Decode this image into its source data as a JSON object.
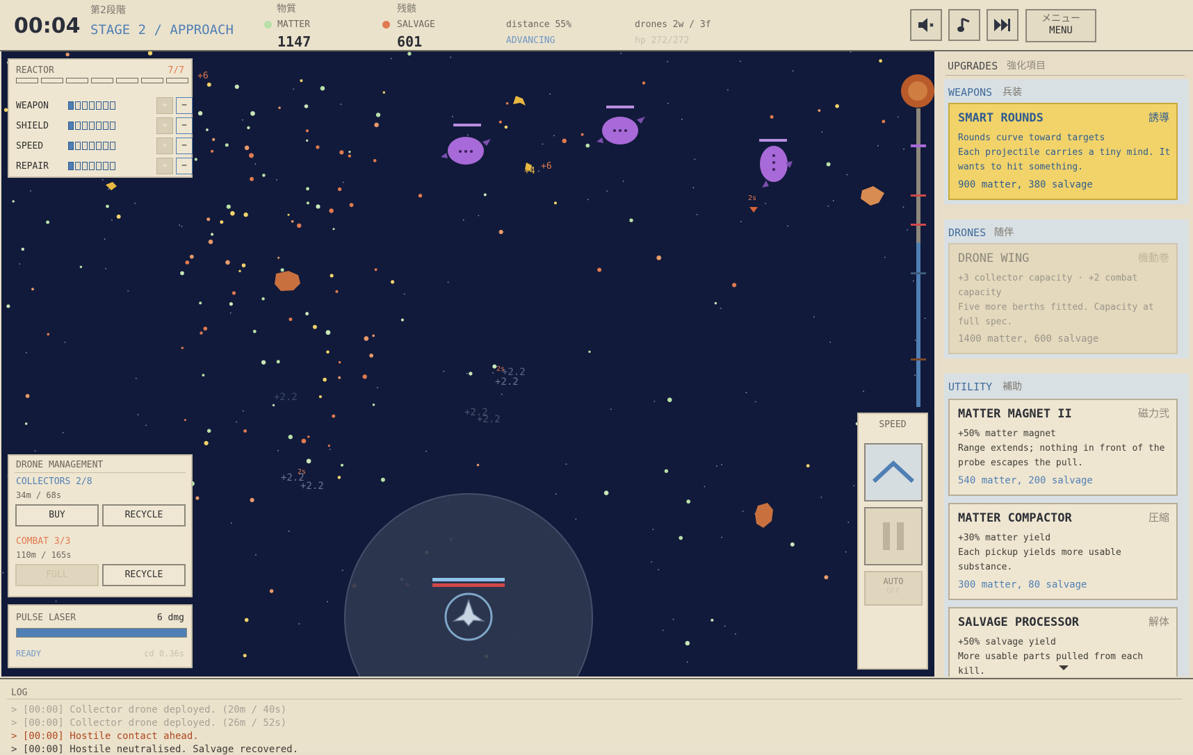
{
  "header": {
    "timer": "00:04",
    "stage_jp": "第2段階",
    "stage": "STAGE 2 / APPROACH",
    "matter_jp": "物質",
    "matter_label": "MATTER",
    "matter_value": "1147",
    "salvage_jp": "残骸",
    "salvage_label": "SALVAGE",
    "salvage_value": "601",
    "distance": "distance 55%",
    "status": "ADVANCING",
    "drones": "drones 2w / 3f",
    "hp": "hp 272/272",
    "menu_jp": "メニュー",
    "menu_label": "MENU"
  },
  "reactor": {
    "title": "REACTOR",
    "count": "7/7",
    "rows": [
      {
        "label": "WEAPON"
      },
      {
        "label": "SHIELD"
      },
      {
        "label": "SPEED"
      },
      {
        "label": "REPAIR"
      }
    ],
    "plus": "+",
    "minus": "−"
  },
  "drone_mgmt": {
    "title": "DRONE MANAGEMENT",
    "collectors": "COLLECTORS  2/8",
    "collectors_time": "34m / 68s",
    "buy": "BUY",
    "recycle": "RECYCLE",
    "combat": "COMBAT  3/3",
    "combat_time": "110m / 165s",
    "full": "FULL",
    "recycle2": "RECYCLE"
  },
  "laser": {
    "title": "PULSE LASER",
    "dmg": "6 dmg",
    "ready": "READY",
    "cd": "cd 0.36s",
    "charge": 1.0
  },
  "speed_panel": {
    "title": "SPEED",
    "auto": "AUTO",
    "auto_state": "OFF"
  },
  "floaters": [
    "+6",
    "+4",
    "+6",
    "+2.2",
    "+2.2",
    "+2.2",
    "+2.2",
    "+2.2",
    "+2.2",
    "+2.2",
    "2s",
    "2s",
    "2s"
  ],
  "upgrades": {
    "title": "UPGRADES",
    "title_jp": "強化項目",
    "weapons": {
      "title": "WEAPONS",
      "jp": "兵装",
      "card": {
        "title": "SMART ROUNDS",
        "jp": "誘導",
        "desc1": "Rounds curve toward targets",
        "desc2": "Each projectile carries a tiny mind. It wants to hit something.",
        "cost": "900 matter, 380 salvage"
      }
    },
    "drones": {
      "title": "DRONES",
      "jp": "随伴",
      "card": {
        "title": "DRONE WING",
        "jp": "機動巻",
        "desc1": "+3 collector capacity · +2 combat capacity",
        "desc2": "Five more berths fitted. Capacity at full spec.",
        "cost": "1400 matter, 600 salvage"
      }
    },
    "utility": {
      "title": "UTILITY",
      "jp": "補助",
      "cards": [
        {
          "title": "MATTER MAGNET II",
          "jp": "磁力弐",
          "desc1": "+50% matter magnet",
          "desc2": "Range extends; nothing in front of the probe escapes the pull.",
          "cost": "540 matter, 200 salvage"
        },
        {
          "title": "MATTER COMPACTOR",
          "jp": "圧縮",
          "desc1": "+30% matter yield",
          "desc2": "Each pickup yields more usable substance.",
          "cost": "300 matter, 80 salvage"
        },
        {
          "title": "SALVAGE PROCESSOR",
          "jp": "解体",
          "desc1": "+50% salvage yield",
          "desc2": "More usable parts pulled from each kill."
        }
      ]
    }
  },
  "log": {
    "title": "LOG",
    "lines": [
      "> [00:00] Collector drone deployed. (20m / 40s)",
      "> [00:00] Collector drone deployed. (26m / 52s)",
      "> [00:00] Hostile contact ahead.",
      "> [00:00] Hostile neutralised. Salvage recovered."
    ]
  },
  "colors": {
    "space": "#111a3a",
    "accent_blue": "#4f7fb4",
    "accent_orange": "#e07a50",
    "matter_green": "#b8e0a8",
    "enemy_purple": "#a86ad8",
    "highlight_card": "#f2d36a"
  }
}
